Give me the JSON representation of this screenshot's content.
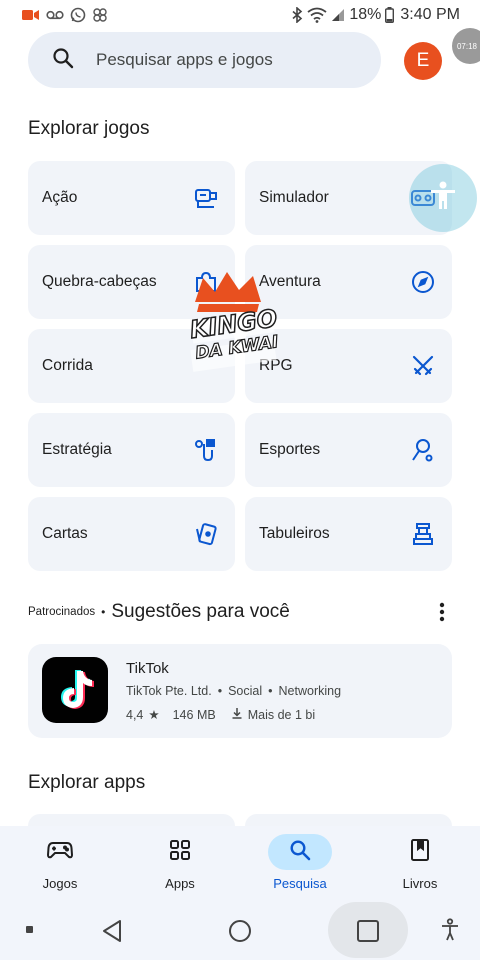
{
  "statusbar": {
    "battery": "18%",
    "time": "3:40 PM",
    "icons": [
      "video-record-icon",
      "voicemail-icon",
      "whatsapp-icon",
      "gallery-icon",
      "bluetooth-icon",
      "wifi-icon",
      "signal-icon",
      "battery-icon"
    ]
  },
  "search": {
    "placeholder": "Pesquisar apps e jogos"
  },
  "avatar": {
    "initial": "E",
    "color": "#e8501f"
  },
  "bubble": {
    "text": "07:18"
  },
  "explore_games": {
    "title": "Explorar jogos",
    "categories": [
      {
        "label": "Ação",
        "icon": "action-game-icon"
      },
      {
        "label": "Simulador",
        "icon": "simulator-icon"
      },
      {
        "label": "Quebra-cabeças",
        "icon": "puzzle-icon"
      },
      {
        "label": "Aventura",
        "icon": "compass-icon"
      },
      {
        "label": "Corrida",
        "icon": "racing-icon"
      },
      {
        "label": "RPG",
        "icon": "swords-icon"
      },
      {
        "label": "Estratégia",
        "icon": "strategy-icon"
      },
      {
        "label": "Esportes",
        "icon": "sports-icon"
      },
      {
        "label": "Cartas",
        "icon": "cards-icon"
      },
      {
        "label": "Tabuleiros",
        "icon": "board-game-icon"
      }
    ]
  },
  "suggestions": {
    "sponsored": "Patrocinados",
    "title": "Sugestões para você",
    "app": {
      "name": "TikTok",
      "developer": "TikTok Pte. Ltd.",
      "category": "Social",
      "subcategory": "Networking",
      "rating": "4,4",
      "size": "146 MB",
      "downloads": "Mais de 1 bi"
    }
  },
  "explore_apps": {
    "title": "Explorar apps"
  },
  "bottom_nav": {
    "items": [
      {
        "label": "Jogos",
        "icon": "gamepad-icon",
        "active": false
      },
      {
        "label": "Apps",
        "icon": "apps-grid-icon",
        "active": false
      },
      {
        "label": "Pesquisa",
        "icon": "search-icon",
        "active": true
      },
      {
        "label": "Livros",
        "icon": "book-icon",
        "active": false
      }
    ]
  },
  "watermark": {
    "line1": "KINGO",
    "line2": "DA KWAI"
  },
  "colors": {
    "accent": "#0b57d0",
    "card_bg": "#f1f4f9",
    "search_bg": "#e9eef6",
    "active_pill": "#c2e7ff"
  }
}
